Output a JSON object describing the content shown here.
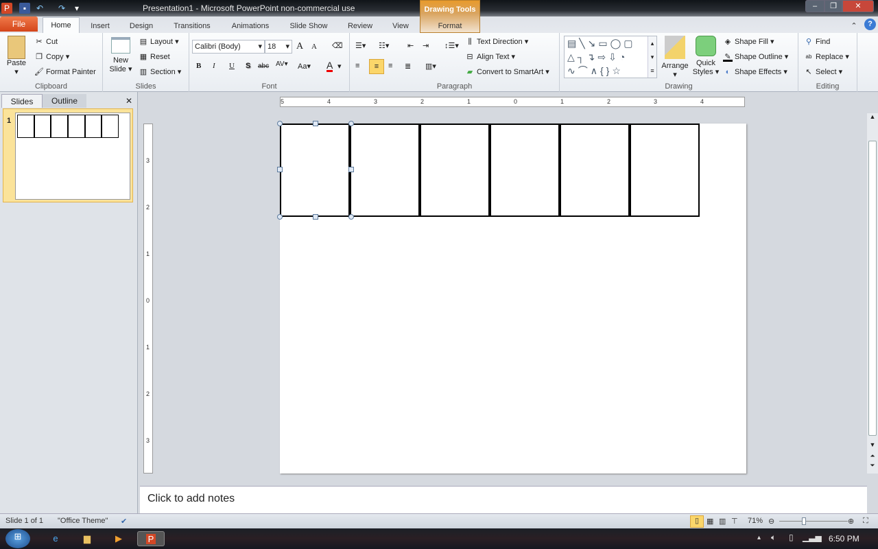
{
  "window": {
    "title": "Presentation1  -  Microsoft PowerPoint non-commercial use",
    "contextual_tab_group": "Drawing Tools"
  },
  "tabs": {
    "file": "File",
    "home": "Home",
    "items": [
      "Insert",
      "Design",
      "Transitions",
      "Animations",
      "Slide Show",
      "Review",
      "View"
    ],
    "format": "Format"
  },
  "ribbon": {
    "clipboard": {
      "label": "Clipboard",
      "paste": "Paste",
      "cut": "Cut",
      "copy": "Copy",
      "format_painter": "Format Painter"
    },
    "slides": {
      "label": "Slides",
      "new_slide_1": "New",
      "new_slide_2": "Slide",
      "layout": "Layout",
      "reset": "Reset",
      "section": "Section"
    },
    "font": {
      "label": "Font",
      "font_name": "Calibri (Body)",
      "font_size": "18",
      "bold": "B",
      "italic": "I",
      "underline": "U",
      "shadow": "S",
      "strike": "abc",
      "spacing": "AV",
      "case": "Aa",
      "color": "A",
      "grow": "A",
      "shrink": "A"
    },
    "paragraph": {
      "label": "Paragraph",
      "text_direction": "Text Direction",
      "align_text": "Align Text",
      "convert_smartart": "Convert to SmartArt"
    },
    "drawing": {
      "label": "Drawing",
      "arrange": "Arrange",
      "quick_styles_1": "Quick",
      "quick_styles_2": "Styles",
      "shape_fill": "Shape Fill",
      "shape_outline": "Shape Outline",
      "shape_effects": "Shape Effects"
    },
    "editing": {
      "label": "Editing",
      "find": "Find",
      "replace": "Replace",
      "select": "Select"
    }
  },
  "left_pane": {
    "tabs": [
      "Slides",
      "Outline"
    ],
    "slide_number": "1"
  },
  "rulers": {
    "horizontal": [
      "5",
      "4",
      "3",
      "2",
      "1",
      "0",
      "1",
      "2",
      "3",
      "4"
    ],
    "vertical": [
      "3",
      "2",
      "1",
      "0",
      "1",
      "2",
      "3"
    ]
  },
  "notes": {
    "placeholder": "Click to add notes"
  },
  "status": {
    "slide": "Slide 1 of 1",
    "theme": "\"Office Theme\"",
    "zoom": "71%",
    "zoom_fraction": 0.71
  },
  "taskbar": {
    "time": "6:50 PM"
  },
  "colors": {
    "file_tab": "#d4451a",
    "drawing_tools": "#e89a2c",
    "selected_align": "#fbd66a"
  }
}
